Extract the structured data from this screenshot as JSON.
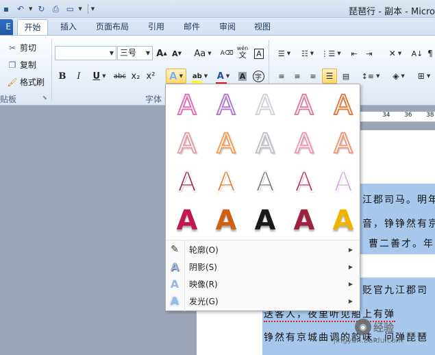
{
  "window": {
    "title": "琵琶行 - 副本 - Micro"
  },
  "tabs": {
    "file": "E",
    "items": [
      "开始",
      "插入",
      "页面布局",
      "引用",
      "邮件",
      "审阅",
      "视图"
    ],
    "active": "开始"
  },
  "clipboard": {
    "cut": "剪切",
    "copy": "复制",
    "format_painter": "格式刷",
    "group_label": "贴板"
  },
  "font": {
    "font_name": "",
    "font_size": "三号",
    "group_label": "字体",
    "bold": "B",
    "italic": "I",
    "underline": "U",
    "strikethrough": "abc",
    "subscript": "x₂",
    "superscript": "x²",
    "grow": "A",
    "shrink": "A",
    "change_case": "Aa",
    "phonetic": "wén",
    "char_border": "A",
    "text_effects": "A",
    "highlight": "ab",
    "font_color": "A",
    "char_shading": "A",
    "enclose": "字",
    "colors": {
      "highlight_bar": "#ffff00",
      "font_color_bar": "#e0201b"
    }
  },
  "text_effects_gallery": {
    "glyph": "A",
    "rows": [
      [
        "#e06fb4",
        "#b07ad0",
        "#cfd2d6",
        "#e07ea8",
        "#e07b39"
      ],
      [
        "#e5a0ae",
        "#f2a05a",
        "#bfc3c8",
        "#f09ab8",
        "#ef9a78"
      ],
      [
        "#a0223f",
        "#e8762a",
        "#7a7a7a",
        "#c02d54",
        "#d7a3e0"
      ],
      [
        "#c2184f",
        "#d06010",
        "#1a1a1a",
        "#a02040",
        "#f0b400"
      ]
    ],
    "menu": [
      {
        "label": "轮廓(O)",
        "icon": "outline-pen-icon"
      },
      {
        "label": "阴影(S)",
        "icon": "shadow-a-icon"
      },
      {
        "label": "映像(R)",
        "icon": "reflection-a-icon"
      },
      {
        "label": "发光(G)",
        "icon": "glow-a-icon"
      }
    ]
  },
  "ruler": {
    "labels": [
      "34",
      "36",
      "38"
    ]
  },
  "document": {
    "lines": [
      "江郡司马。明年",
      "音，铮铮然有京",
      "曹二善才。年",
      "贬官九江郡司",
      "送客人，夜里听见船上有弹",
      "铮然有京城曲调的韵味。问弹琵琶"
    ]
  },
  "watermark": {
    "brand": "经验",
    "url": "jingyan.baidu.com"
  }
}
